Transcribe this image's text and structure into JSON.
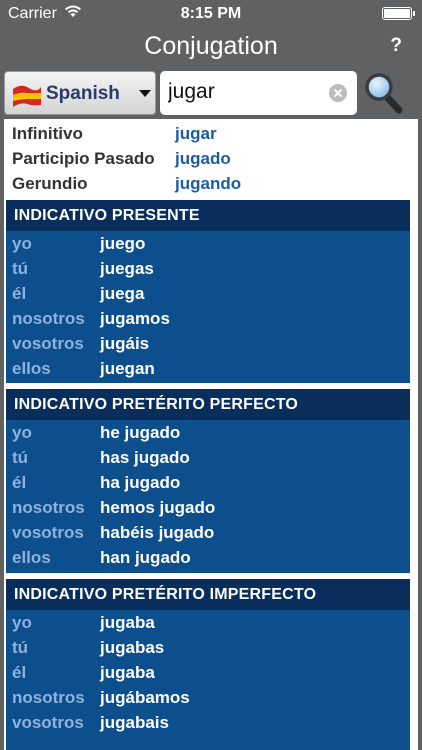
{
  "status": {
    "carrier": "Carrier",
    "time": "8:15 PM"
  },
  "header": {
    "title": "Conjugation",
    "help": "?"
  },
  "search": {
    "language": "Spanish",
    "query": "jugar"
  },
  "forms": [
    {
      "label": "Infinitivo",
      "value": "jugar"
    },
    {
      "label": "Participio Pasado",
      "value": "jugado"
    },
    {
      "label": "Gerundio",
      "value": "jugando"
    }
  ],
  "tenses": [
    {
      "name": "INDICATIVO PRESENTE",
      "rows": [
        {
          "pronoun": "yo",
          "form": "juego"
        },
        {
          "pronoun": "tú",
          "form": "juegas"
        },
        {
          "pronoun": "él",
          "form": "juega"
        },
        {
          "pronoun": "nosotros",
          "form": "jugamos"
        },
        {
          "pronoun": "vosotros",
          "form": "jugáis"
        },
        {
          "pronoun": "ellos",
          "form": "juegan"
        }
      ]
    },
    {
      "name": "INDICATIVO PRETÉRITO PERFECTO",
      "rows": [
        {
          "pronoun": "yo",
          "form": "he jugado"
        },
        {
          "pronoun": "tú",
          "form": "has jugado"
        },
        {
          "pronoun": "él",
          "form": "ha jugado"
        },
        {
          "pronoun": "nosotros",
          "form": "hemos jugado"
        },
        {
          "pronoun": "vosotros",
          "form": "habéis jugado"
        },
        {
          "pronoun": "ellos",
          "form": "han jugado"
        }
      ]
    },
    {
      "name": "INDICATIVO PRETÉRITO IMPERFECTO",
      "rows": [
        {
          "pronoun": "yo",
          "form": "jugaba"
        },
        {
          "pronoun": "tú",
          "form": "jugabas"
        },
        {
          "pronoun": "él",
          "form": "jugaba"
        },
        {
          "pronoun": "nosotros",
          "form": "jugábamos"
        },
        {
          "pronoun": "vosotros",
          "form": "jugabais"
        }
      ]
    }
  ]
}
